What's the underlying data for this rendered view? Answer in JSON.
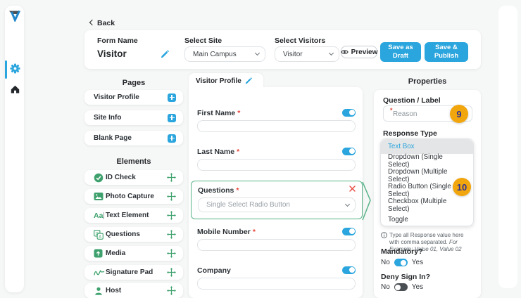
{
  "required_marker": "*",
  "nav": {
    "back_label": "Back"
  },
  "topbar": {
    "form_name_label": "Form Name",
    "form_name_value": "Visitor",
    "select_site_label": "Select Site",
    "site_value": "Main Campus",
    "select_visitors_label": "Select Visitors",
    "visitors_value": "Visitor",
    "preview_label": "Preview",
    "save_draft_label": "Save as Draft",
    "save_publish_label": "Save & Publish"
  },
  "pages": {
    "title": "Pages",
    "items": [
      {
        "label": "Visitor Profile"
      },
      {
        "label": "Site Info"
      },
      {
        "label": "Blank Page"
      }
    ]
  },
  "elements": {
    "title": "Elements",
    "items": [
      {
        "label": "ID Check",
        "icon": "id-check-icon"
      },
      {
        "label": "Photo Capture",
        "icon": "photo-capture-icon"
      },
      {
        "label": "Text Element",
        "icon": "text-element-icon"
      },
      {
        "label": "Questions",
        "icon": "questions-icon"
      },
      {
        "label": "Media",
        "icon": "media-icon"
      },
      {
        "label": "Signature Pad",
        "icon": "signature-pad-icon"
      },
      {
        "label": "Host",
        "icon": "host-icon"
      }
    ]
  },
  "canvas": {
    "tab_label": "Visitor Profile",
    "fields": [
      {
        "label": "First Name",
        "required": true
      },
      {
        "label": "Last Name",
        "required": true
      },
      {
        "label": "Questions",
        "required": true,
        "selected": true,
        "value": "Single Select Radio Button"
      },
      {
        "label": "Mobile Number",
        "required": true
      },
      {
        "label": "Company",
        "required": false
      }
    ]
  },
  "properties": {
    "title": "Properties",
    "question_label": "Question / Label",
    "question_value": "Reason",
    "response_type_label": "Response Type",
    "options": [
      {
        "label": "Text Box",
        "selected": true
      },
      {
        "label": "Dropdown (Single Select)"
      },
      {
        "label": "Dropdown (Multiple Select)"
      },
      {
        "label": "Radio Button (Single Select)"
      },
      {
        "label": "Checkbox (Multiple Select)"
      },
      {
        "label": "Toggle"
      }
    ],
    "info_text": "Type all Response value here with comma separated. ",
    "info_text_em": "For Example: Value 01, Value 02",
    "mandatory_label": "Mandatory?",
    "deny_label": "Deny Sign In?",
    "no_label": "No",
    "yes_label": "Yes"
  },
  "badges": {
    "step9": "9",
    "step10": "10"
  },
  "colors": {
    "accent": "#2aa5dd",
    "green": "#3ea16d",
    "green_border": "#58b388",
    "orange": "#f2a60d",
    "badge_text": "#2e3192",
    "red": "#e8453c"
  }
}
